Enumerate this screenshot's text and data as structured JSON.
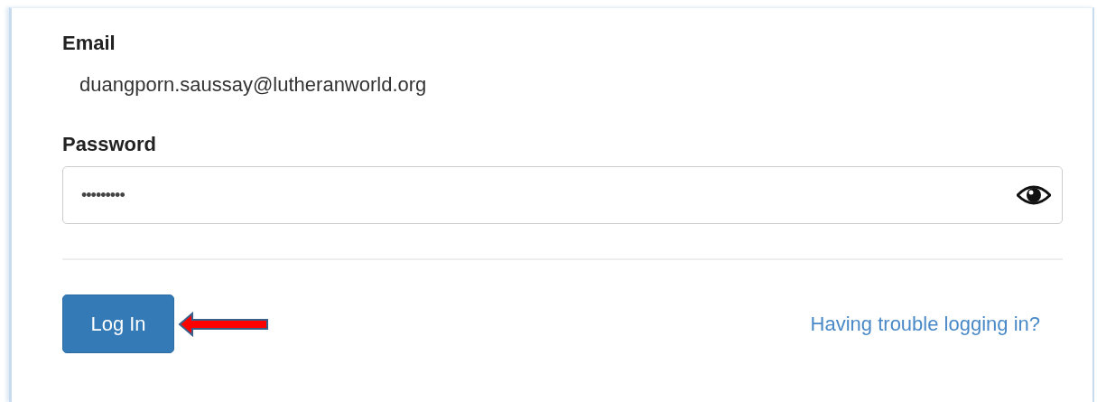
{
  "email": {
    "label": "Email",
    "value": "duangporn.saussay@lutheranworld.org"
  },
  "password": {
    "label": "Password",
    "value": "•••••••••"
  },
  "login_button": {
    "label": "Log In"
  },
  "help_link": {
    "label": "Having trouble logging in?"
  }
}
